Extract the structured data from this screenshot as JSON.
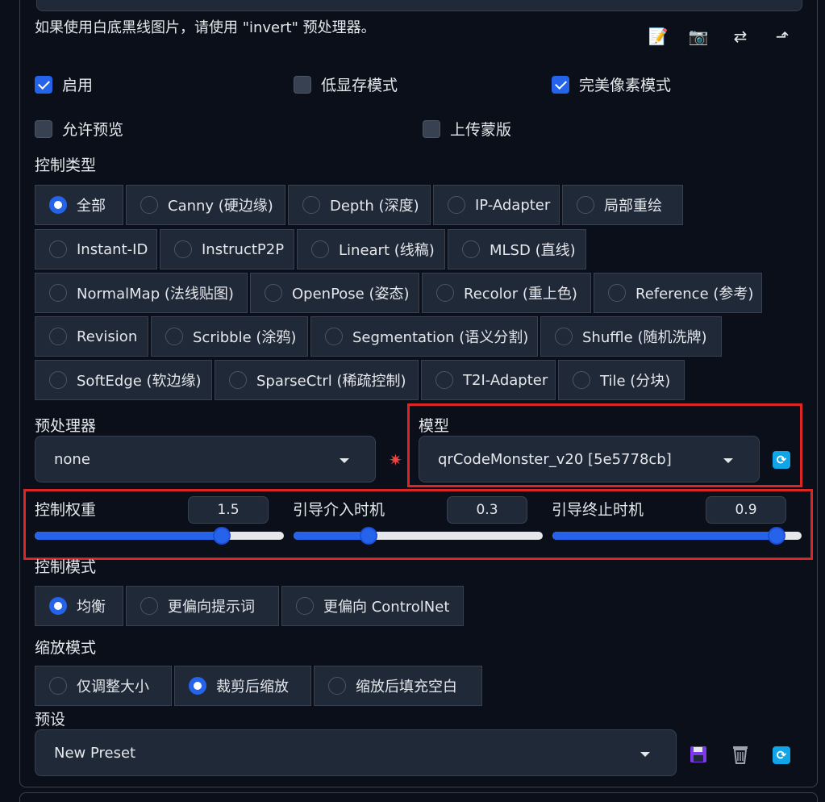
{
  "hint": "如果使用白底黑线图片，请使用 \"invert\" 预处理器。",
  "tools": [
    "edit-icon",
    "camera-icon",
    "swap-icon",
    "rotate-icon"
  ],
  "checkboxes": {
    "enable": {
      "label": "启用",
      "checked": true
    },
    "low_vram": {
      "label": "低显存模式",
      "checked": false
    },
    "pixel_perfect": {
      "label": "完美像素模式",
      "checked": true
    },
    "allow_preview": {
      "label": "允许预览",
      "checked": false
    },
    "upload_mask": {
      "label": "上传蒙版",
      "checked": false
    }
  },
  "control_type": {
    "label": "控制类型",
    "options": [
      "全部",
      "Canny (硬边缘)",
      "Depth (深度)",
      "IP-Adapter",
      "局部重绘",
      "Instant-ID",
      "InstructP2P",
      "Lineart (线稿)",
      "MLSD (直线)",
      "NormalMap (法线贴图)",
      "OpenPose (姿态)",
      "Recolor (重上色)",
      "Reference (参考)",
      "Revision",
      "Scribble (涂鸦)",
      "Segmentation (语义分割)",
      "Shuffle (随机洗牌)",
      "SoftEdge (软边缘)",
      "SparseCtrl (稀疏控制)",
      "T2I-Adapter",
      "Tile (分块)"
    ],
    "selected": "全部"
  },
  "preprocessor": {
    "label": "预处理器",
    "value": "none"
  },
  "model": {
    "label": "模型",
    "value": "qrCodeMonster_v20 [5e5778cb]"
  },
  "sliders": {
    "weight": {
      "label": "控制权重",
      "value": "1.5",
      "fraction": 0.75
    },
    "start": {
      "label": "引导介入时机",
      "value": "0.3",
      "fraction": 0.3
    },
    "end": {
      "label": "引导终止时机",
      "value": "0.9",
      "fraction": 0.9
    }
  },
  "control_mode": {
    "label": "控制模式",
    "options": [
      "均衡",
      "更偏向提示词",
      "更偏向 ControlNet"
    ],
    "selected": "均衡"
  },
  "resize_mode": {
    "label": "缩放模式",
    "options": [
      "仅调整大小",
      "裁剪后缩放",
      "缩放后填充空白"
    ],
    "selected": "裁剪后缩放"
  },
  "preset": {
    "label": "预设",
    "value": "New Preset"
  },
  "colors": {
    "accent": "#2563eb",
    "highlight": "#dc2626",
    "refresh": "#0ea5e9"
  }
}
